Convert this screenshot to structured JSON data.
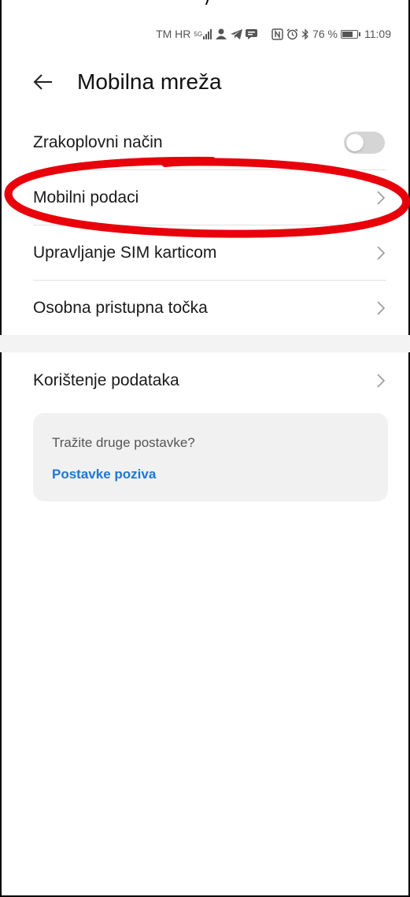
{
  "status_bar": {
    "carrier": "TM HR",
    "network": "5G",
    "battery": "76 %",
    "battery_level": 0.76,
    "time": "11:09",
    "icons": [
      "signal-icon",
      "avatar-icon",
      "telegram-icon",
      "message-icon",
      "nfc-icon",
      "alarm-icon",
      "bluetooth-icon",
      "battery-icon"
    ]
  },
  "header": {
    "back_icon": "arrow-left-icon",
    "title": "Mobilna mreža"
  },
  "list": {
    "airplane_mode": {
      "label": "Zrakoplovni način",
      "enabled": false
    },
    "mobile_data": {
      "label": "Mobilni podaci"
    },
    "sim_management": {
      "label": "Upravljanje SIM karticom"
    },
    "hotspot": {
      "label": "Osobna pristupna točka"
    },
    "data_usage": {
      "label": "Korištenje podataka"
    }
  },
  "card": {
    "question": "Tražite druge postavke?",
    "link": "Postavke poziva"
  },
  "colors": {
    "accent": "#1e77d3",
    "annotation": "#e8000b",
    "toggle_off": "#d5d5d5"
  }
}
